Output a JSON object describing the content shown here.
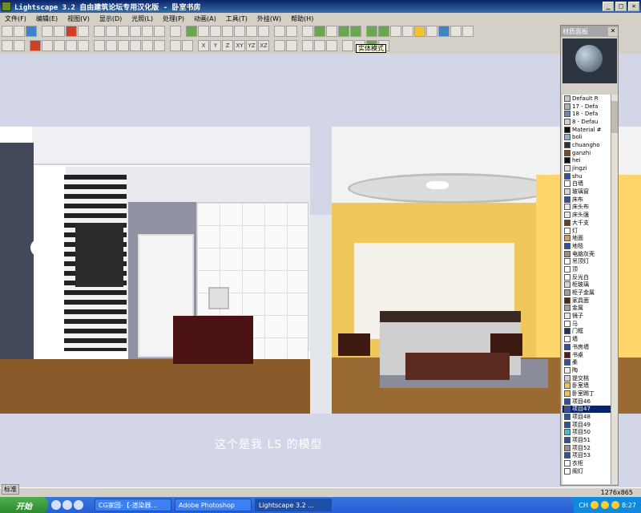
{
  "window": {
    "title": "Lightscape 3.2 自由建筑论坛专用汉化版  - 卧室书房"
  },
  "menu": [
    "文件(F)",
    "编辑(E)",
    "视图(V)",
    "显示(D)",
    "光照(L)",
    "处理(P)",
    "动画(A)",
    "工具(T)",
    "外挂(W)",
    "帮助(H)"
  ],
  "tooltip": "实体模式",
  "viewport": {
    "caption": "这个是我 LS 的模型"
  },
  "material_panel": {
    "title": "材质面板",
    "items": [
      {
        "label": "Default R",
        "color": "#c8c8c8"
      },
      {
        "label": "17 - Defa",
        "color": "#b0b0b0"
      },
      {
        "label": "18 - Defa",
        "color": "#6a8ab0"
      },
      {
        "label": "8 - Defau",
        "color": "#d0d0d0"
      },
      {
        "label": "Material #",
        "color": "#101010"
      },
      {
        "label": "boli",
        "color": "#8ab0d0"
      },
      {
        "label": "chuangho",
        "color": "#303030"
      },
      {
        "label": "ganzhi",
        "color": "#7a4a20"
      },
      {
        "label": "hei",
        "color": "#101010"
      },
      {
        "label": "jingzi",
        "color": "#e0e0e0"
      },
      {
        "label": "shu",
        "color": "#3050a0"
      },
      {
        "label": "白墙",
        "color": "#ffffff"
      },
      {
        "label": "玻璃窗",
        "color": "#d0d8e0"
      },
      {
        "label": "床布",
        "color": "#3050a0"
      },
      {
        "label": "床头布",
        "color": "#e8e8e8"
      },
      {
        "label": "床头强",
        "color": "#f0e8d8"
      },
      {
        "label": "大千支",
        "color": "#6a4020"
      },
      {
        "label": "灯",
        "color": "#ffffff"
      },
      {
        "label": "地面",
        "color": "#d0a060"
      },
      {
        "label": "地毯",
        "color": "#3050a0"
      },
      {
        "label": "电脑灰壳",
        "color": "#909090"
      },
      {
        "label": "吊顶灯",
        "color": "#ffffff"
      },
      {
        "label": "顶",
        "color": "#ffffff"
      },
      {
        "label": "反光白",
        "color": "#ffffff"
      },
      {
        "label": "柜玻璃",
        "color": "#d0d8e0"
      },
      {
        "label": "柜子金属",
        "color": "#a0a0a0"
      },
      {
        "label": "家具面",
        "color": "#4a2a14"
      },
      {
        "label": "金属",
        "color": "#a0a0a0"
      },
      {
        "label": "镜子",
        "color": "#e0e8f0"
      },
      {
        "label": "马",
        "color": "#ffffff"
      },
      {
        "label": "门框",
        "color": "#203060"
      },
      {
        "label": "墙",
        "color": "#ffffff"
      },
      {
        "label": "书房墙",
        "color": "#3050a0"
      },
      {
        "label": "书桌",
        "color": "#5a1818"
      },
      {
        "label": "柔",
        "color": "#3050a0"
      },
      {
        "label": "陶",
        "color": "#f0f0f0"
      },
      {
        "label": "提交桃",
        "color": "#d0d0d0"
      },
      {
        "label": "卧室墙",
        "color": "#f0c060"
      },
      {
        "label": "卧室踢丁",
        "color": "#f0c060"
      },
      {
        "label": "项目46",
        "color": "#3050a0"
      },
      {
        "label": "项目47",
        "color": "#3050a0"
      },
      {
        "label": "项目48",
        "color": "#3050a0"
      },
      {
        "label": "项目49",
        "color": "#3050a0"
      },
      {
        "label": "项目50",
        "color": "#40c0d0"
      },
      {
        "label": "项目51",
        "color": "#3050a0"
      },
      {
        "label": "项目52",
        "color": "#909090"
      },
      {
        "label": "项目53",
        "color": "#3050a0"
      },
      {
        "label": "衣柜",
        "color": "#ffffff"
      },
      {
        "label": "阁灯",
        "color": "#ffffff"
      }
    ],
    "selected_index": 40
  },
  "status": {
    "resolution": "1276x865"
  },
  "bottom_tabs": [
    "标准"
  ],
  "taskbar": {
    "start_label": "开始",
    "tasks": [
      "CG家园-【-渲染器...",
      "Adobe Photoshop",
      "Lightscape 3.2 ..."
    ],
    "active_task": 2,
    "tray_lang": "CH",
    "clock": "8:27"
  }
}
